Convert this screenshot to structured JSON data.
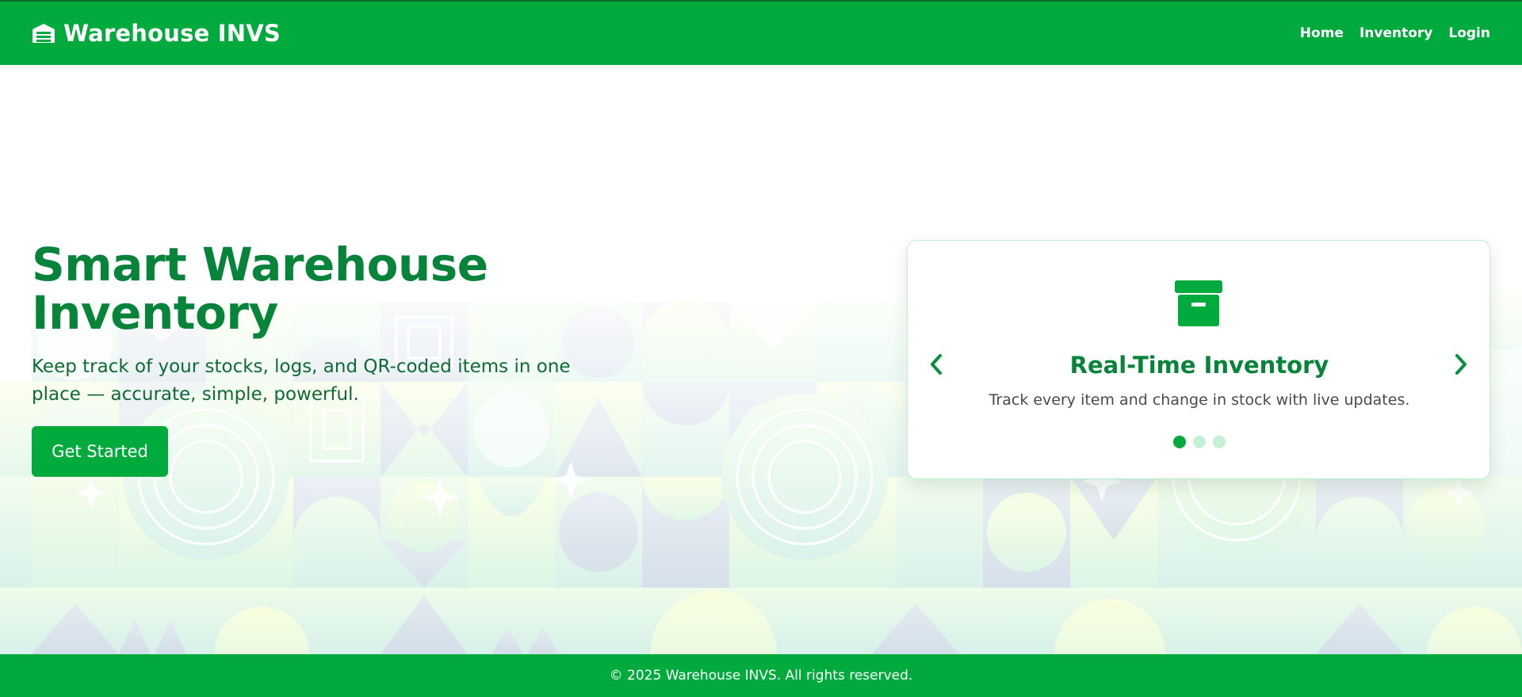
{
  "colors": {
    "brand_green": "#00aa3c",
    "title_green": "#08843a",
    "text_dark": "#444b52",
    "dot_inactive": "#c4f0d5"
  },
  "navbar": {
    "brand_icon": "warehouse-icon",
    "brand_name": "Warehouse INVS",
    "links": [
      {
        "label": "Home"
      },
      {
        "label": "Inventory"
      },
      {
        "label": "Login"
      }
    ]
  },
  "hero": {
    "title_line1": "Smart Warehouse",
    "title_line2": "Inventory",
    "subtitle": "Keep track of your stocks, logs, and QR-coded items in one place — accurate, simple, powerful.",
    "cta_label": "Get Started"
  },
  "carousel": {
    "active_index": 0,
    "slide": {
      "icon": "archive-box-icon",
      "title": "Real-Time Inventory",
      "description": "Track every item and change in stock with live updates."
    },
    "prev_icon": "chevron-left-icon",
    "next_icon": "chevron-right-icon",
    "slide_count": 3
  },
  "footer": {
    "text": "© 2025 Warehouse INVS. All rights reserved."
  }
}
